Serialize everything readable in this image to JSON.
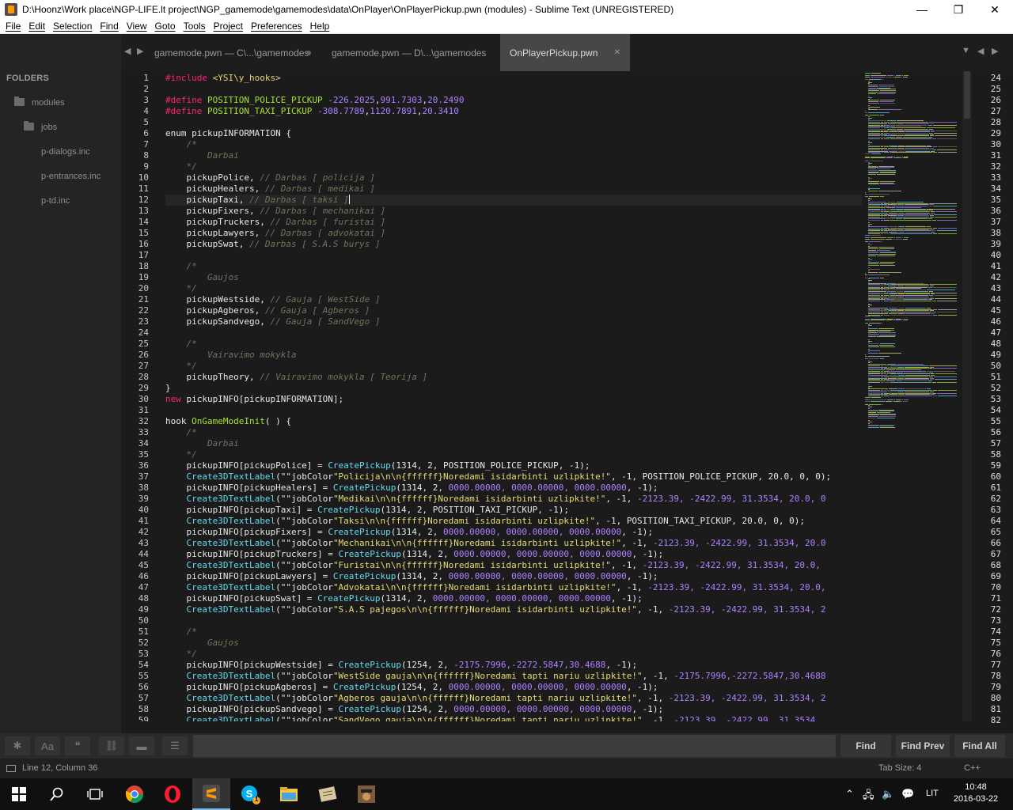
{
  "window": {
    "title": "D:\\Hoonz\\Work place\\NGP-LIFE.lt project\\NGP_gamemode\\gamemodes\\data\\OnPlayer\\OnPlayerPickup.pwn (modules) - Sublime Text (UNREGISTERED)",
    "minimize": "—",
    "maximize": "❐",
    "close": "✕"
  },
  "menu": [
    "File",
    "Edit",
    "Selection",
    "Find",
    "View",
    "Goto",
    "Tools",
    "Project",
    "Preferences",
    "Help"
  ],
  "sidebar": {
    "header": "FOLDERS",
    "items": [
      {
        "label": "modules",
        "type": "folder"
      },
      {
        "label": "jobs",
        "type": "folder"
      },
      {
        "label": "p-dialogs.inc",
        "type": "file"
      },
      {
        "label": "p-entrances.inc",
        "type": "file"
      },
      {
        "label": "p-td.inc",
        "type": "file"
      }
    ]
  },
  "tabs": [
    {
      "label": "gamemode.pwn — C\\...\\gamemodes",
      "active": false,
      "dirty": true
    },
    {
      "label": "gamemode.pwn — D\\...\\gamemodes",
      "active": false,
      "dirty": false
    },
    {
      "label": "OnPlayerPickup.pwn",
      "active": true,
      "dirty": false
    }
  ],
  "tab_nav": {
    "prev": "◀",
    "next": "▶",
    "dropdown": "▼"
  },
  "editor": {
    "cursor_line": 12,
    "lines": [
      [
        [
          "#include",
          "kw"
        ],
        [
          " <YSI\\y_hooks>",
          "str"
        ]
      ],
      [],
      [
        [
          "#define",
          "kw"
        ],
        [
          " POSITION_POLICE_PICKUP ",
          "fn"
        ],
        [
          "-226.2025",
          "num"
        ],
        [
          ",",
          "id"
        ],
        [
          "991.7303",
          "num"
        ],
        [
          ",",
          "id"
        ],
        [
          "20.2490",
          "num"
        ]
      ],
      [
        [
          "#define",
          "kw"
        ],
        [
          " POSITION_TAXI_PICKUP ",
          "fn"
        ],
        [
          "-308.7789",
          "num"
        ],
        [
          ",",
          "id"
        ],
        [
          "1120.7891",
          "num"
        ],
        [
          ",",
          "id"
        ],
        [
          "20.3410",
          "num"
        ]
      ],
      [],
      [
        [
          "enum ",
          "id"
        ],
        [
          "pickupINFORMATION ",
          "id"
        ],
        [
          "{",
          "id"
        ]
      ],
      [
        [
          "    /*",
          "com"
        ]
      ],
      [
        [
          "        Darbai",
          "com"
        ]
      ],
      [
        [
          "    */",
          "com"
        ]
      ],
      [
        [
          "    pickupPolice, ",
          "id"
        ],
        [
          "// Darbas [ policija ]",
          "com"
        ]
      ],
      [
        [
          "    pickupHealers, ",
          "id"
        ],
        [
          "// Darbas [ medikai ]",
          "com"
        ]
      ],
      [
        [
          "    pickupTaxi, ",
          "id"
        ],
        [
          "// Darbas [ taksi ]",
          "com"
        ]
      ],
      [
        [
          "    pickupFixers, ",
          "id"
        ],
        [
          "// Darbas [ mechanikai ]",
          "com"
        ]
      ],
      [
        [
          "    pickupTruckers, ",
          "id"
        ],
        [
          "// Darbas [ furistai ]",
          "com"
        ]
      ],
      [
        [
          "    pickupLawyers, ",
          "id"
        ],
        [
          "// Darbas [ advokatai ]",
          "com"
        ]
      ],
      [
        [
          "    pickupSwat, ",
          "id"
        ],
        [
          "// Darbas [ S.A.S burys ]",
          "com"
        ]
      ],
      [],
      [
        [
          "    /*",
          "com"
        ]
      ],
      [
        [
          "        Gaujos",
          "com"
        ]
      ],
      [
        [
          "    */",
          "com"
        ]
      ],
      [
        [
          "    pickupWestside, ",
          "id"
        ],
        [
          "// Gauja [ WestSide ]",
          "com"
        ]
      ],
      [
        [
          "    pickupAgberos, ",
          "id"
        ],
        [
          "// Gauja [ Agberos ]",
          "com"
        ]
      ],
      [
        [
          "    pickupSandvego, ",
          "id"
        ],
        [
          "// Gauja [ SandVego ]",
          "com"
        ]
      ],
      [],
      [
        [
          "    /*",
          "com"
        ]
      ],
      [
        [
          "        Vairavimo mokykla",
          "com"
        ]
      ],
      [
        [
          "    */",
          "com"
        ]
      ],
      [
        [
          "    pickupTheory, ",
          "id"
        ],
        [
          "// Vairavimo mokykla [ Teorija ]",
          "com"
        ]
      ],
      [
        [
          "}",
          "id"
        ]
      ],
      [
        [
          "new ",
          "kw"
        ],
        [
          "pickupINFO[pickupINFORMATION];",
          "id"
        ]
      ],
      [],
      [
        [
          "hook ",
          "id"
        ],
        [
          "OnGameModeInit",
          "fn"
        ],
        [
          "( ) {",
          "id"
        ]
      ],
      [
        [
          "    /*",
          "com"
        ]
      ],
      [
        [
          "        Darbai",
          "com"
        ]
      ],
      [
        [
          "    */",
          "com"
        ]
      ],
      [
        [
          "    pickupINFO[pickupPolice] = ",
          "id"
        ],
        [
          "CreatePickup",
          "api"
        ],
        [
          "(1314, 2, POSITION_POLICE_PICKUP, -1);",
          "id"
        ]
      ],
      [
        [
          "    Create3DTextLabel",
          "api"
        ],
        [
          "(\"\"",
          "id"
        ],
        [
          "jobColor",
          "id"
        ],
        [
          "\"Policija\\n\\n{ffffff}Noredami isidarbinti uzlipkite!\"",
          "str"
        ],
        [
          ", -1, POSITION_POLICE_PICKUP, 20.0, 0, 0);",
          "id"
        ]
      ],
      [
        [
          "    pickupINFO[pickupHealers] = ",
          "id"
        ],
        [
          "CreatePickup",
          "api"
        ],
        [
          "(1314, 2, ",
          "id"
        ],
        [
          "0000.00000, 0000.00000, 0000.00000",
          "num"
        ],
        [
          ", -1);",
          "id"
        ]
      ],
      [
        [
          "    Create3DTextLabel",
          "api"
        ],
        [
          "(\"\"",
          "id"
        ],
        [
          "jobColor",
          "id"
        ],
        [
          "\"Medikai\\n\\n{ffffff}Noredami isidarbinti uzlipkite!\"",
          "str"
        ],
        [
          ", -1, ",
          "id"
        ],
        [
          "-2123.39, -2422.99, 31.3534, 20.0, 0",
          "num"
        ]
      ],
      [
        [
          "    pickupINFO[pickupTaxi] = ",
          "id"
        ],
        [
          "CreatePickup",
          "api"
        ],
        [
          "(1314, 2, POSITION_TAXI_PICKUP, -1);",
          "id"
        ]
      ],
      [
        [
          "    Create3DTextLabel",
          "api"
        ],
        [
          "(\"\"",
          "id"
        ],
        [
          "jobColor",
          "id"
        ],
        [
          "\"Taksi\\n\\n{ffffff}Noredami isidarbinti uzlipkite!\"",
          "str"
        ],
        [
          ", -1, POSITION_TAXI_PICKUP, 20.0, 0, 0);",
          "id"
        ]
      ],
      [
        [
          "    pickupINFO[pickupFixers] = ",
          "id"
        ],
        [
          "CreatePickup",
          "api"
        ],
        [
          "(1314, 2, ",
          "id"
        ],
        [
          "0000.00000, 0000.00000, 0000.00000",
          "num"
        ],
        [
          ", -1);",
          "id"
        ]
      ],
      [
        [
          "    Create3DTextLabel",
          "api"
        ],
        [
          "(\"\"",
          "id"
        ],
        [
          "jobColor",
          "id"
        ],
        [
          "\"Mechanikai\\n\\n{ffffff}Noredami isidarbinti uzlipkite!\"",
          "str"
        ],
        [
          ", -1, ",
          "id"
        ],
        [
          "-2123.39, -2422.99, 31.3534, 20.0",
          "num"
        ]
      ],
      [
        [
          "    pickupINFO[pickupTruckers] = ",
          "id"
        ],
        [
          "CreatePickup",
          "api"
        ],
        [
          "(1314, 2, ",
          "id"
        ],
        [
          "0000.00000, 0000.00000, 0000.00000",
          "num"
        ],
        [
          ", -1);",
          "id"
        ]
      ],
      [
        [
          "    Create3DTextLabel",
          "api"
        ],
        [
          "(\"\"",
          "id"
        ],
        [
          "jobColor",
          "id"
        ],
        [
          "\"Furistai\\n\\n{ffffff}Noredami isidarbinti uzlipkite!\"",
          "str"
        ],
        [
          ", -1, ",
          "id"
        ],
        [
          "-2123.39, -2422.99, 31.3534, 20.0,",
          "num"
        ]
      ],
      [
        [
          "    pickupINFO[pickupLawyers] = ",
          "id"
        ],
        [
          "CreatePickup",
          "api"
        ],
        [
          "(1314, 2, ",
          "id"
        ],
        [
          "0000.00000, 0000.00000, 0000.00000",
          "num"
        ],
        [
          ", -1);",
          "id"
        ]
      ],
      [
        [
          "    Create3DTextLabel",
          "api"
        ],
        [
          "(\"\"",
          "id"
        ],
        [
          "jobColor",
          "id"
        ],
        [
          "\"Advokatai\\n\\n{ffffff}Noredami isidarbinti uzlipkite!\"",
          "str"
        ],
        [
          ", -1, ",
          "id"
        ],
        [
          "-2123.39, -2422.99, 31.3534, 20.0,",
          "num"
        ]
      ],
      [
        [
          "    pickupINFO[pickupSwat] = ",
          "id"
        ],
        [
          "CreatePickup",
          "api"
        ],
        [
          "(1314, 2, ",
          "id"
        ],
        [
          "0000.00000, 0000.00000, 0000.00000",
          "num"
        ],
        [
          ", -1);",
          "id"
        ]
      ],
      [
        [
          "    Create3DTextLabel",
          "api"
        ],
        [
          "(\"\"",
          "id"
        ],
        [
          "jobColor",
          "id"
        ],
        [
          "\"S.A.S pajegos\\n\\n{ffffff}Noredami isidarbinti uzlipkite!\"",
          "str"
        ],
        [
          ", -1, ",
          "id"
        ],
        [
          "-2123.39, -2422.99, 31.3534, 2",
          "num"
        ]
      ],
      [],
      [
        [
          "    /*",
          "com"
        ]
      ],
      [
        [
          "        Gaujos",
          "com"
        ]
      ],
      [
        [
          "    */",
          "com"
        ]
      ],
      [
        [
          "    pickupINFO[pickupWestside] = ",
          "id"
        ],
        [
          "CreatePickup",
          "api"
        ],
        [
          "(1254, 2, ",
          "id"
        ],
        [
          "-2175.7996,-2272.5847,30.4688",
          "num"
        ],
        [
          ", -1);",
          "id"
        ]
      ],
      [
        [
          "    Create3DTextLabel",
          "api"
        ],
        [
          "(\"\"",
          "id"
        ],
        [
          "jobColor",
          "id"
        ],
        [
          "\"WestSide gauja\\n\\n{ffffff}Noredami tapti nariu uzlipkite!\"",
          "str"
        ],
        [
          ", -1, ",
          "id"
        ],
        [
          "-2175.7996,-2272.5847,30.4688",
          "num"
        ]
      ],
      [
        [
          "    pickupINFO[pickupAgberos] = ",
          "id"
        ],
        [
          "CreatePickup",
          "api"
        ],
        [
          "(1254, 2, ",
          "id"
        ],
        [
          "0000.00000, 0000.00000, 0000.00000",
          "num"
        ],
        [
          ", -1);",
          "id"
        ]
      ],
      [
        [
          "    Create3DTextLabel",
          "api"
        ],
        [
          "(\"\"",
          "id"
        ],
        [
          "jobColor",
          "id"
        ],
        [
          "\"Agberos gauja\\n\\n{ffffff}Noredami tapti nariu uzlipkite!\"",
          "str"
        ],
        [
          ", -1, ",
          "id"
        ],
        [
          "-2123.39, -2422.99, 31.3534, 2",
          "num"
        ]
      ],
      [
        [
          "    pickupINFO[pickupSandvego] = ",
          "id"
        ],
        [
          "CreatePickup",
          "api"
        ],
        [
          "(1254, 2, ",
          "id"
        ],
        [
          "0000.00000, 0000.00000, 0000.00000",
          "num"
        ],
        [
          ", -1);",
          "id"
        ]
      ],
      [
        [
          "    Create3DTextLabel",
          "api"
        ],
        [
          "(\"\"",
          "id"
        ],
        [
          "jobColor",
          "id"
        ],
        [
          "\"SandVego gauja\\n\\n{ffffff}Noredami tapti nariu uzlipkite!\"",
          "str"
        ],
        [
          ", -1, ",
          "id"
        ],
        [
          "-2123.39, -2422.99, 31.3534",
          "num"
        ]
      ]
    ]
  },
  "right_pane_lines": [
    "24",
    "25",
    "26",
    "27",
    "28",
    "29",
    "30",
    "31",
    "32",
    "33",
    "34",
    "35",
    "36",
    "37",
    "38",
    "39",
    "40",
    "41",
    "42",
    "43",
    "44",
    "45",
    "46",
    "47",
    "48",
    "49",
    "50",
    "51",
    "52",
    "53",
    "54",
    "55",
    "56",
    "57",
    "58",
    "59",
    "60",
    "61",
    "62",
    "63",
    "64",
    "65",
    "66",
    "67",
    "68",
    "69",
    "70",
    "71",
    "72",
    "73",
    "74",
    "75",
    "76",
    "77",
    "78",
    "79",
    "80",
    "81",
    "82"
  ],
  "findbar": {
    "options": [
      {
        "name": "regex-toggle",
        "glyph": "✱"
      },
      {
        "name": "case-toggle",
        "glyph": "Aa"
      },
      {
        "name": "word-toggle",
        "glyph": "❝"
      },
      {
        "name": "wrap-toggle",
        "glyph": "⛓"
      },
      {
        "name": "in-selection-toggle",
        "glyph": "▬"
      },
      {
        "name": "highlight-toggle",
        "glyph": "☰"
      }
    ],
    "find": "Find",
    "find_prev": "Find Prev",
    "find_all": "Find All"
  },
  "status": {
    "position": "Line 12, Column 36",
    "tab_size": "Tab Size: 4",
    "syntax": "C++"
  },
  "taskbar": {
    "time": "10:48",
    "date": "2016-03-22",
    "lang": "LIT",
    "apps": [
      "start",
      "search",
      "task-view",
      "chrome",
      "opera",
      "sublime-text",
      "skype",
      "file-explorer",
      "app-note",
      "app-avatar"
    ],
    "skype_badge": "1"
  },
  "colors": {
    "keyword": "#f92672",
    "function": "#a6e22e",
    "string": "#e6db74",
    "number": "#ae81ff",
    "comment": "#75715e",
    "api": "#66d9ef"
  }
}
